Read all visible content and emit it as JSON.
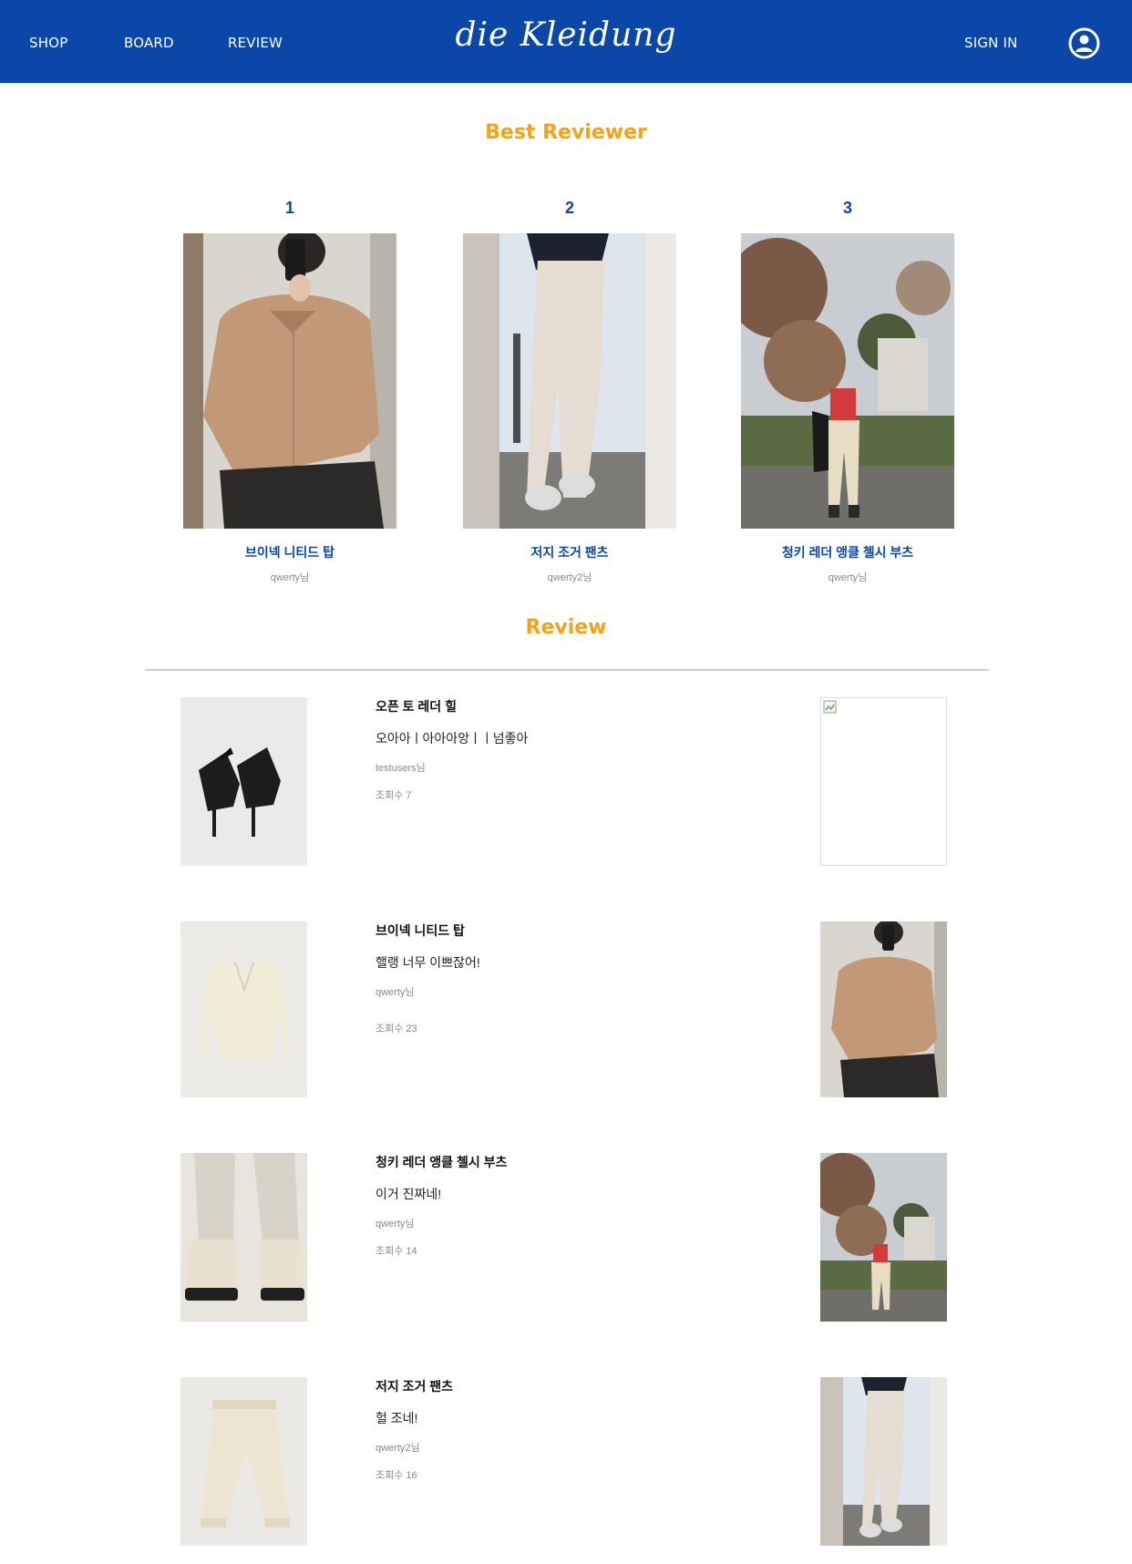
{
  "nav": {
    "shop": "SHOP",
    "board": "BOARD",
    "review": "REVIEW",
    "brand": "die Kleidung",
    "sign_in": "SIGN IN",
    "user_icon": "user-circle-icon"
  },
  "colors": {
    "header": "#0b47a8",
    "title_accent": "#f5a316",
    "product_link": "#0b47a8"
  },
  "best_section": {
    "title": "Best Reviewer",
    "cards": [
      {
        "rank": "1",
        "product": "브이넥 니티드 탑",
        "user": "qwerty님"
      },
      {
        "rank": "2",
        "product": "저지 조거 팬츠",
        "user": "qwerty2님"
      },
      {
        "rank": "3",
        "product": "청키 레더 앵클 첼시 부츠",
        "user": "qwerty님"
      }
    ]
  },
  "review_section": {
    "title": "Review",
    "items": [
      {
        "title": "오픈 토 레더 힐",
        "body": "오아아ㅣ아아아앙ㅣㅣ넘좋아",
        "user": "testusers님",
        "views": "조회수 7"
      },
      {
        "title": "브이넥 니티드 탑",
        "body": "핼랭 너무 이쁘잖어!",
        "user": "qwerty님",
        "views": "조회수 23"
      },
      {
        "title": "청키 레더 앵클 첼시 부츠",
        "body": "이거 진짜네!",
        "user": "qwerty님",
        "views": "조회수 14"
      },
      {
        "title": "저지 조거 팬츠",
        "body": "헐 조네!",
        "user": "qwerty2님",
        "views": "조회수 16"
      }
    ]
  }
}
